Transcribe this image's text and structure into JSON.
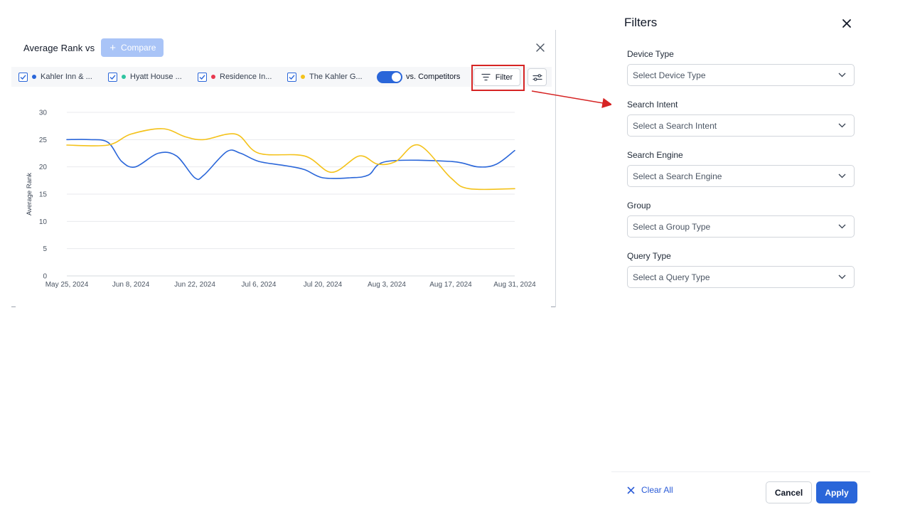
{
  "card": {
    "title": "Average Rank vs",
    "compare_label": "Compare",
    "legend": [
      {
        "label": "Kahler Inn & ...",
        "color": "#2a66d9",
        "checked": true
      },
      {
        "label": "Hyatt House ...",
        "color": "#2ec4a0",
        "checked": true
      },
      {
        "label": "Residence In...",
        "color": "#e8384f",
        "checked": true
      },
      {
        "label": "The Kahler G...",
        "color": "#f4c21a",
        "checked": true
      }
    ],
    "toggle_label": "vs. Competitors",
    "toggle_on": true,
    "filter_label": "Filter"
  },
  "chart_data": {
    "type": "line",
    "ylabel": "Average Rank",
    "xlabel": "",
    "ylim": [
      0,
      30
    ],
    "yticks": [
      0,
      5,
      10,
      15,
      20,
      25,
      30
    ],
    "xticks": [
      "May 25, 2024",
      "Jun 8, 2024",
      "Jun 22, 2024",
      "Jul 6, 2024",
      "Jul 20, 2024",
      "Aug 3, 2024",
      "Aug 17, 2024",
      "Aug 31, 2024"
    ],
    "grid": true,
    "series": [
      {
        "color": "#2a66d9",
        "points": [
          [
            "May 25, 2024",
            25
          ],
          [
            "May 30, 2024",
            25
          ],
          [
            "Jun 3, 2024",
            24.5
          ],
          [
            "Jun 6, 2024",
            21
          ],
          [
            "Jun 9, 2024",
            20
          ],
          [
            "Jun 14, 2024",
            22.5
          ],
          [
            "Jun 18, 2024",
            22
          ],
          [
            "Jun 22, 2024",
            18
          ],
          [
            "Jun 24, 2024",
            18.5
          ],
          [
            "Jun 29, 2024",
            22.8
          ],
          [
            "Jul 2, 2024",
            22.5
          ],
          [
            "Jul 6, 2024",
            21
          ],
          [
            "Jul 12, 2024",
            20.2
          ],
          [
            "Jul 16, 2024",
            19.5
          ],
          [
            "Jul 20, 2024",
            18
          ],
          [
            "Jul 26, 2024",
            18
          ],
          [
            "Jul 30, 2024",
            18.5
          ],
          [
            "Aug 3, 2024",
            21
          ],
          [
            "Aug 17, 2024",
            21
          ],
          [
            "Aug 23, 2024",
            20
          ],
          [
            "Aug 27, 2024",
            20.5
          ],
          [
            "Aug 31, 2024",
            23
          ]
        ]
      },
      {
        "color": "#f4c21a",
        "points": [
          [
            "May 25, 2024",
            24
          ],
          [
            "Jun 3, 2024",
            24
          ],
          [
            "Jun 8, 2024",
            26
          ],
          [
            "Jun 15, 2024",
            27
          ],
          [
            "Jun 20, 2024",
            25.5
          ],
          [
            "Jun 24, 2024",
            25
          ],
          [
            "Jul 1, 2024",
            26
          ],
          [
            "Jul 6, 2024",
            22.5
          ],
          [
            "Jul 16, 2024",
            22
          ],
          [
            "Jul 22, 2024",
            19
          ],
          [
            "Jul 28, 2024",
            22
          ],
          [
            "Aug 1, 2024",
            20.5
          ],
          [
            "Aug 5, 2024",
            21
          ],
          [
            "Aug 10, 2024",
            24
          ],
          [
            "Aug 17, 2024",
            18
          ],
          [
            "Aug 21, 2024",
            16
          ],
          [
            "Aug 31, 2024",
            16
          ]
        ]
      }
    ]
  },
  "panel": {
    "title": "Filters",
    "fields": [
      {
        "label": "Device Type",
        "placeholder": "Select Device Type"
      },
      {
        "label": "Search Intent",
        "placeholder": "Select a Search Intent"
      },
      {
        "label": "Search Engine",
        "placeholder": "Select a Search Engine"
      },
      {
        "label": "Group",
        "placeholder": "Select a Group Type"
      },
      {
        "label": "Query Type",
        "placeholder": "Select a Query Type"
      }
    ],
    "clear_label": "Clear All",
    "cancel_label": "Cancel",
    "apply_label": "Apply"
  },
  "colors": {
    "accent": "#2a66d9",
    "compare_button": "#a9c4f7",
    "highlight": "#d62424",
    "legend_bar": "#f6f7f9"
  }
}
